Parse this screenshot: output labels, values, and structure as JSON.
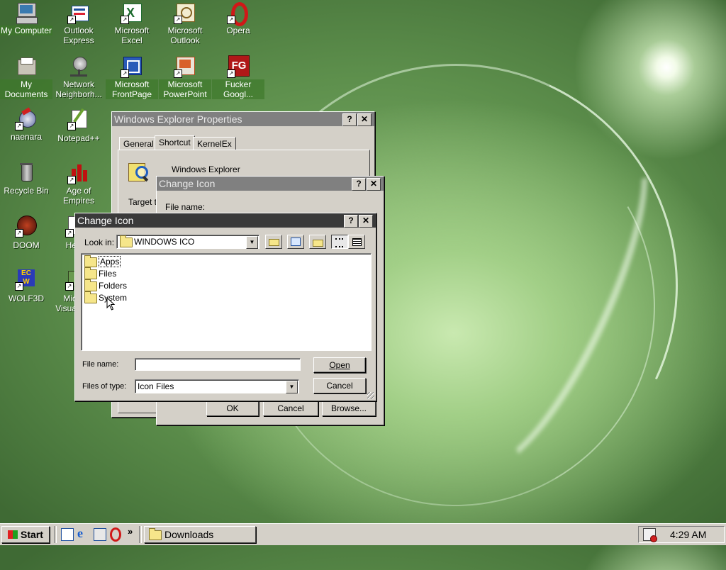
{
  "desktop": {
    "icons": [
      {
        "label": "My Computer",
        "selected": true
      },
      {
        "label": "Outlook Express",
        "selected": false
      },
      {
        "label": "Microsoft Excel",
        "selected": false
      },
      {
        "label": "Microsoft Outlook",
        "selected": false
      },
      {
        "label": "Opera",
        "selected": false
      },
      {
        "label": "My Documents",
        "selected": true
      },
      {
        "label": "Network Neighborh...",
        "selected": false
      },
      {
        "label": "Microsoft FrontPage",
        "selected": true
      },
      {
        "label": "Microsoft PowerPoint",
        "selected": true
      },
      {
        "label": "Fucker Googl...",
        "selected": true
      },
      {
        "label": "naenara",
        "selected": false
      },
      {
        "label": "Notepad++",
        "selected": false
      },
      {
        "label": "Recycle Bin",
        "selected": false
      },
      {
        "label": "Age of Empires",
        "selected": false
      },
      {
        "label": "DOOM",
        "selected": false
      },
      {
        "label": "He",
        "selected": false
      },
      {
        "label": "WOLF3D",
        "selected": false
      },
      {
        "label": "Mic Visua",
        "selected": false
      }
    ]
  },
  "properties_window": {
    "title": "Windows Explorer Properties",
    "tabs": [
      "General",
      "Shortcut",
      "KernelEx"
    ],
    "active_tab": "Shortcut",
    "shortcut_name": "Windows Explorer",
    "target_label": "Target ty",
    "help": "?",
    "close": "✕"
  },
  "change_icon_back": {
    "title": "Change Icon",
    "file_name_label": "File name:",
    "ok": "OK",
    "cancel": "Cancel",
    "browse": "Browse..."
  },
  "change_icon_dialog": {
    "title": "Change Icon",
    "look_in_label": "Look in:",
    "look_in_value": "WINDOWS ICO",
    "folders": [
      "Apps",
      "Files",
      "Folders",
      "System"
    ],
    "file_name_label": "File name:",
    "file_name_value": "",
    "files_of_type_label": "Files of type:",
    "files_of_type_value": "Icon Files",
    "open": "Open",
    "cancel": "Cancel"
  },
  "taskbar": {
    "start": "Start",
    "quick_launch_more": "»",
    "task": "Downloads",
    "time": "4:29 AM"
  }
}
